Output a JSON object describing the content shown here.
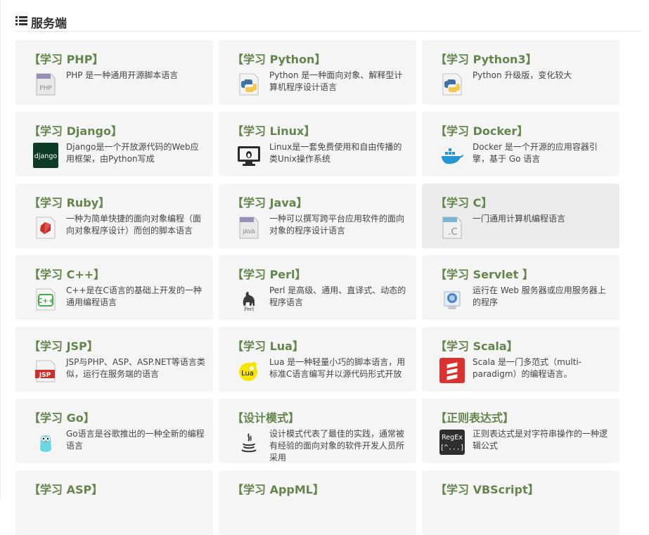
{
  "section": {
    "title": "服务端",
    "icon": "list-icon"
  },
  "colors": {
    "accent": "#64854c",
    "card_bg": "#f5f5f5",
    "text": "#444444"
  },
  "cards": [
    {
      "title": "【学习 PHP】",
      "desc": "PHP 是一种通用开源脚本语言",
      "icon": "php-icon"
    },
    {
      "title": "【学习 Python】",
      "desc": "Python 是一种面向对象、解释型计算机程序设计语言",
      "icon": "python-icon"
    },
    {
      "title": "【学习 Python3】",
      "desc": "Python 升级版，变化较大",
      "icon": "python3-icon"
    },
    {
      "title": "【学习 Django】",
      "desc": "Django是一个开放源代码的Web应用框架，由Python写成",
      "icon": "django-icon"
    },
    {
      "title": "【学习 Linux】",
      "desc": "Linux是一套免费使用和自由传播的类Unix操作系统",
      "icon": "linux-icon"
    },
    {
      "title": "【学习 Docker】",
      "desc": "Docker 是一个开源的应用容器引擎，基于 Go 语言",
      "icon": "docker-icon"
    },
    {
      "title": "【学习 Ruby】",
      "desc": "一种为简单快捷的面向对象编程（面向对象程序设计）而创的脚本语言",
      "icon": "ruby-icon"
    },
    {
      "title": "【学习 Java】",
      "desc": "一种可以撰写跨平台应用软件的面向对象的程序设计语言",
      "icon": "java-icon"
    },
    {
      "title": "【学习 C】",
      "desc": "一门通用计算机编程语言",
      "icon": "c-icon"
    },
    {
      "title": "【学习 C++】",
      "desc": "C++是在C语言的基础上开发的一种通用编程语言",
      "icon": "cpp-icon"
    },
    {
      "title": "【学习 Perl】",
      "desc": "Perl 是高级、通用、直译式、动态的程序语言",
      "icon": "perl-icon"
    },
    {
      "title": "【学习 Servlet 】",
      "desc": "运行在 Web 服务器或应用服务器上的程序",
      "icon": "servlet-icon"
    },
    {
      "title": "【学习 JSP】",
      "desc": "JSP与PHP、ASP、ASP.NET等语言类似，运行在服务端的语言",
      "icon": "jsp-icon"
    },
    {
      "title": "【学习 Lua】",
      "desc": "Lua 是一种轻量小巧的脚本语言，用标准C语言编写并以源代码形式开放",
      "icon": "lua-icon"
    },
    {
      "title": "【学习 Scala】",
      "desc": "Scala 是一门多范式（multi-paradigm）的编程语言。",
      "icon": "scala-icon"
    },
    {
      "title": "【学习 Go】",
      "desc": "Go语言是谷歌推出的一种全新的编程语言",
      "icon": "go-icon"
    },
    {
      "title": "【设计模式】",
      "desc": "设计模式代表了最佳的实践，通常被有经验的面向对象的软件开发人员所采用",
      "icon": "design-pattern-icon"
    },
    {
      "title": "【正则表达式】",
      "desc": "正则表达式是对字符串操作的一种逻辑公式",
      "icon": "regex-icon"
    },
    {
      "title": "【学习 ASP】",
      "desc": "",
      "icon": "asp-icon"
    },
    {
      "title": "【学习 AppML】",
      "desc": "",
      "icon": "appml-icon"
    },
    {
      "title": "【学习 VBScript】",
      "desc": "",
      "icon": "vbscript-icon"
    }
  ]
}
